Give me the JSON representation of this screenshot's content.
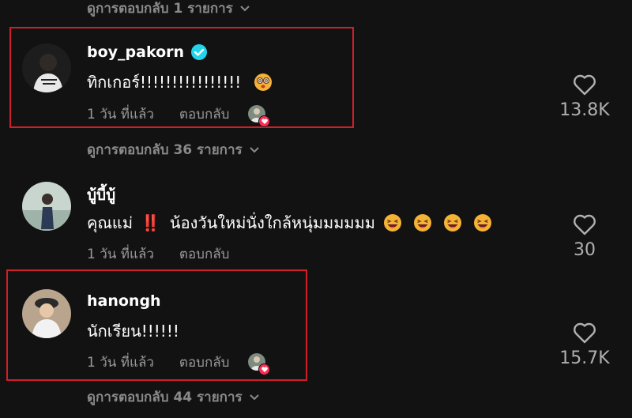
{
  "view_replies_top": {
    "label": "ดูการตอบกลับ 1 รายการ"
  },
  "comments": [
    {
      "username": "boy_pakorn",
      "verified": true,
      "text": "ทิกเกอร์!!!!!!!!!!!!!!!!",
      "emojis": [
        "face-with-spiral-eyes-icon"
      ],
      "time": "1 วัน ที่แล้ว",
      "reply_label": "ตอบกลับ",
      "creator_liked": true,
      "like_count": "13.8K",
      "view_replies": "ดูการตอบกลับ 36 รายการ",
      "highlighted": true
    },
    {
      "username": "บู้บี้บู้",
      "verified": false,
      "text_prefix": "คุณแม่",
      "text_marker": "‼️",
      "text": "น้องวันใหม่นั่งใกล้หนุ่มมมมมม",
      "emojis": [
        "grinning-squinting-face-icon",
        "grinning-squinting-face-icon",
        "grinning-squinting-face-icon",
        "grinning-squinting-face-icon"
      ],
      "time": "1 วัน ที่แล้ว",
      "reply_label": "ตอบกลับ",
      "creator_liked": false,
      "like_count": "30",
      "highlighted": false
    },
    {
      "username": "hanongh",
      "verified": false,
      "text": "นักเรียน!!!!!!",
      "emojis": [],
      "time": "1 วัน ที่แล้ว",
      "reply_label": "ตอบกลับ",
      "creator_liked": true,
      "like_count": "15.7K",
      "view_replies": "ดูการตอบกลับ 44 รายการ",
      "highlighted": true
    }
  ],
  "colors": {
    "background": "#121212",
    "highlight_border": "#d01f2a",
    "verified_badge": "#20d5ec",
    "like_badge": "#fe2c55",
    "muted_text": "#9a9a9a"
  }
}
